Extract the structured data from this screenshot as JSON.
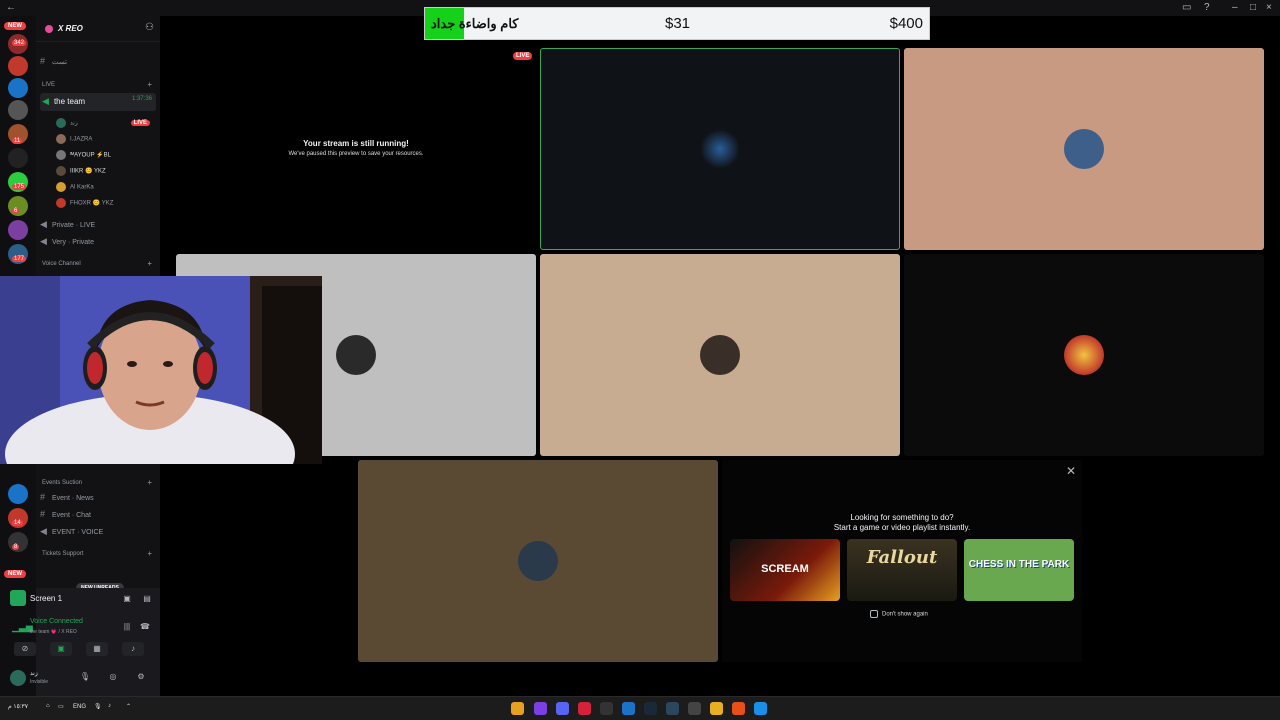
{
  "donation": {
    "goal_text": "كام واضاءة جداد",
    "current": "$31",
    "target": "$400",
    "progress_fraction": 0.0775,
    "bar_color": "#15d11a"
  },
  "server_rail": {
    "top_badge": "NEW",
    "badges": [
      "342",
      "11",
      "175",
      "6",
      "177",
      "14",
      "8"
    ],
    "bottom_badge": "NEW"
  },
  "server": {
    "name": "X REO",
    "channels": {
      "rules": "تست",
      "live_category": "LIVE",
      "active_voice": "the team",
      "timer": "1:37:36",
      "private_live": "Private · LIVE",
      "very_private": "Very · Private",
      "voice_category": "Voice Channel",
      "events_category": "Events Suction",
      "event_news": "Event · News",
      "event_chat": "Event · Chat",
      "event_voice": "EVENT · VOICE",
      "tickets_category": "Tickets Support"
    },
    "voice_users": [
      {
        "name": "زند",
        "live": "LIVE"
      },
      {
        "name": "I.JAZRA"
      },
      {
        "name": "ᴵᴹAYOUP ⚡BL"
      },
      {
        "name": "IIIKR 😊 YKZ"
      },
      {
        "name": "Al KarKa"
      },
      {
        "name": "FHOXR 😊 YKZ"
      }
    ],
    "new_unreads": "NEW UNREADS"
  },
  "panel": {
    "screen": "Screen 1",
    "voice_connected": "Voice Connected",
    "voice_sub": "the team 💗 / X REO",
    "username": "زند",
    "status": "Invisible"
  },
  "stage": {
    "live_tag": "LIVE",
    "paused_title": "Your stream is still running!",
    "paused_sub": "We've paused this preview to save your resources."
  },
  "activity": {
    "line1": "Looking for something to do?",
    "line2": "Start a game or video playlist instantly.",
    "games": [
      "SCREAM",
      "Fallout",
      "CHESS IN THE PARK"
    ],
    "dont_show": "Don't show again"
  },
  "taskbar": {
    "lang": "ENG",
    "time": "١٥:٣٧ م"
  }
}
